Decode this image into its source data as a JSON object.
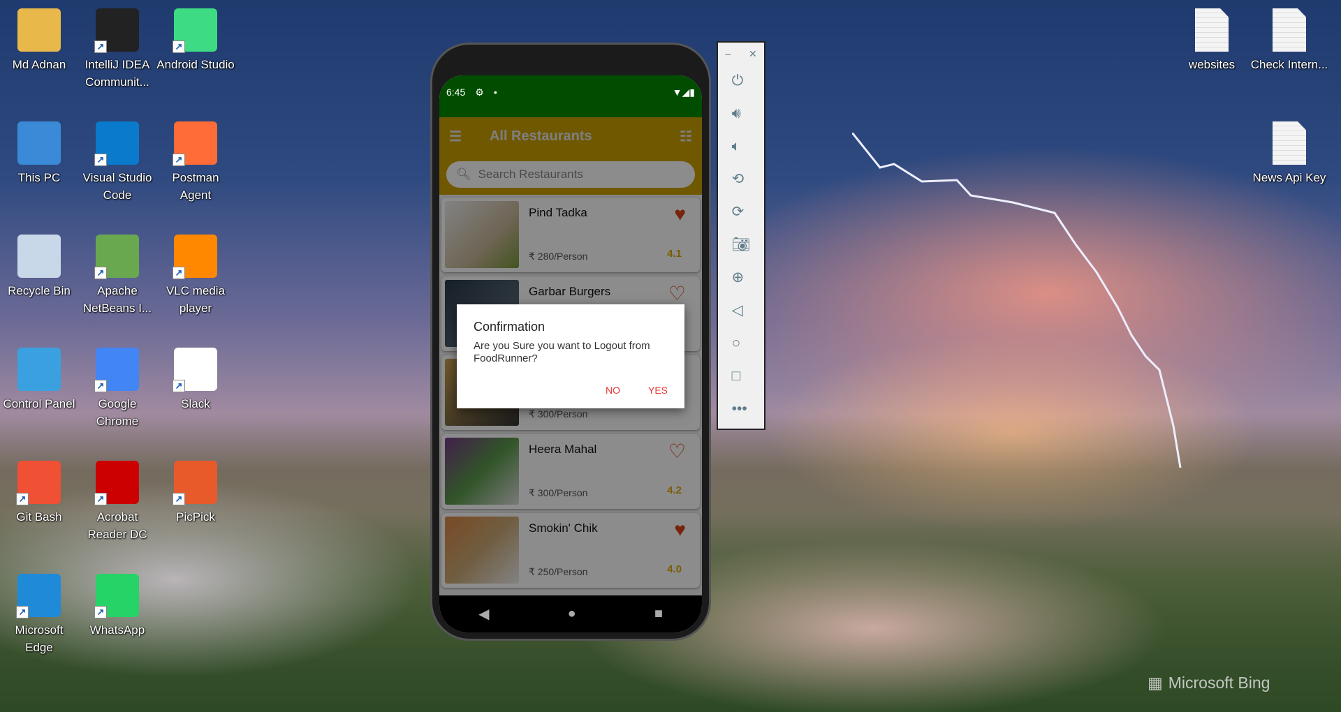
{
  "desktop_left": [
    {
      "label": "Md Adnan",
      "icon": "user-folder-icon",
      "color": "#e8b84a"
    },
    {
      "label": "IntelliJ IDEA Communit...",
      "icon": "intellij-icon",
      "color": "#222"
    },
    {
      "label": "Android Studio",
      "icon": "android-studio-icon",
      "color": "#3ddc84"
    },
    {
      "label": "This PC",
      "icon": "computer-icon",
      "color": "#3a8ad8"
    },
    {
      "label": "Visual Studio Code",
      "icon": "vscode-icon",
      "color": "#0a7acc"
    },
    {
      "label": "Postman Agent",
      "icon": "postman-icon",
      "color": "#ff6c37"
    },
    {
      "label": "Recycle Bin",
      "icon": "recycle-bin-icon",
      "color": "#c8d8e8"
    },
    {
      "label": "Apache NetBeans I...",
      "icon": "netbeans-icon",
      "color": "#6aa84f"
    },
    {
      "label": "VLC media player",
      "icon": "vlc-icon",
      "color": "#ff8800"
    },
    {
      "label": "Control Panel",
      "icon": "control-panel-icon",
      "color": "#3aa0e0"
    },
    {
      "label": "Google Chrome",
      "icon": "chrome-icon",
      "color": "#4285f4"
    },
    {
      "label": "Slack",
      "icon": "slack-icon",
      "color": "#fff"
    },
    {
      "label": "Git Bash",
      "icon": "git-bash-icon",
      "color": "#f05033"
    },
    {
      "label": "Acrobat Reader DC",
      "icon": "acrobat-icon",
      "color": "#c00"
    },
    {
      "label": "PicPick",
      "icon": "picpick-icon",
      "color": "#e85a2a"
    },
    {
      "label": "Microsoft Edge",
      "icon": "edge-icon",
      "color": "#1f8ad8"
    },
    {
      "label": "WhatsApp",
      "icon": "whatsapp-icon",
      "color": "#25d366"
    }
  ],
  "desktop_right": [
    {
      "label": "websites"
    },
    {
      "label": "Check Intern..."
    },
    {
      "label": "News Api Key"
    }
  ],
  "phone": {
    "status": {
      "time": "6:45"
    },
    "toolbar": {
      "title": "All Restaurants"
    },
    "search": {
      "placeholder": "Search Restaurants"
    },
    "restaurants": [
      {
        "name": "Pind Tadka",
        "price": "280/Person",
        "rating": "4.1",
        "favorite": true
      },
      {
        "name": "Garbar Burgers",
        "price": "",
        "rating": "",
        "favorite": false
      },
      {
        "name": "",
        "price": "300/Person",
        "rating": "",
        "favorite": false
      },
      {
        "name": "Heera Mahal",
        "price": "300/Person",
        "rating": "4.2",
        "favorite": false
      },
      {
        "name": "Smokin' Chik",
        "price": "250/Person",
        "rating": "4.0",
        "favorite": true
      }
    ]
  },
  "dialog": {
    "title": "Confirmation",
    "message": "Are you Sure you want to Logout from FoodRunner?",
    "no": "NO",
    "yes": "YES"
  },
  "emulator": {
    "buttons": [
      "power",
      "volume-up",
      "volume-down",
      "rotate-left",
      "rotate-right",
      "screenshot",
      "zoom",
      "back",
      "home",
      "overview",
      "more"
    ]
  },
  "wallpaper": {
    "brand": "Microsoft Bing"
  }
}
